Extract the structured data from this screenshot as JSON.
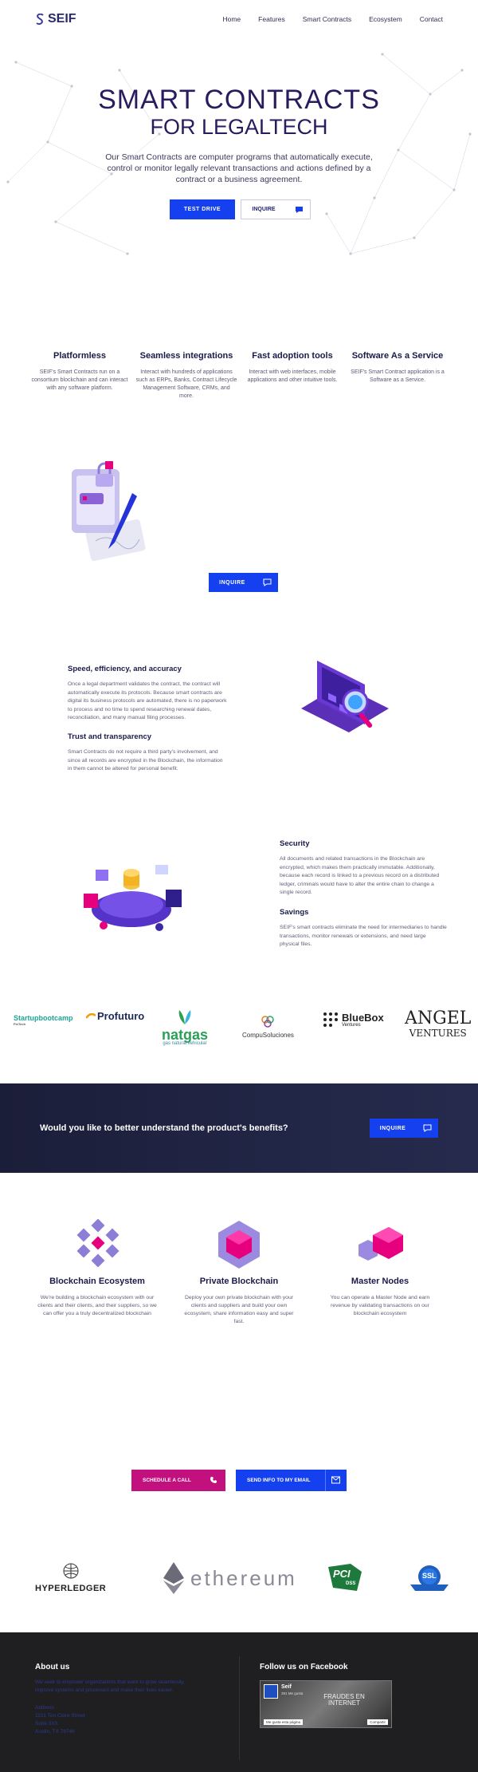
{
  "nav": {
    "brand": "SEIF",
    "links": [
      "Home",
      "Features",
      "Smart Contracts",
      "Ecosystem",
      "Contact"
    ]
  },
  "hero": {
    "title": "SMART CONTRACTS",
    "subtitle": "FOR LEGALTECH",
    "description": "Our Smart Contracts are computer programs that automatically execute, control or monitor legally relevant transactions and actions defined by a contract or a business agreement.",
    "test_drive": "TEST DRIVE",
    "inquire": "INQUIRE"
  },
  "features": [
    {
      "title": "Platformless",
      "text": "SEIF's Smart Contracts run on a consortium blockchain and can interact with any software platform."
    },
    {
      "title": "Seamless integrations",
      "text": "Interact with hundreds of applications such as ERPs, Banks, Contract Lifecycle Management Software, CRMs, and more."
    },
    {
      "title": "Fast adoption tools",
      "text": "Interact with web interfaces, mobile applications and other intuitive tools."
    },
    {
      "title": "Software As a Service",
      "text": "SEIF's Smart Contract application is a Software as a Service."
    }
  ],
  "inquire2": "INQUIRE",
  "benefits1": [
    {
      "title": "Speed, efficiency, and accuracy",
      "text": "Once a legal department validates the contract, the contract will automatically execute its protocols. Because smart contracts are digital its business protocols are automated, there is no paperwork to process and no time to spend researching renewal dates, reconciliation, and many manual filing processes."
    },
    {
      "title": "Trust and transparency",
      "text": "Smart Contracts do not require a third party's involvement, and since all records are encrypted in the Blockchain, the information in them cannot be altered for personal benefit."
    }
  ],
  "benefits2": [
    {
      "title": "Security",
      "text": "All documents and related transactions in the Blockchain are encrypted, which makes them practically immutable. Additionally, because each record is linked to a previous record on a distributed ledger, criminals would have to alter the entire chain to change a single record."
    },
    {
      "title": "Savings",
      "text": "SEIF's smart contracts eliminate the need for intermediaries to handle transactions, monitor renewals or extensions, and need large physical files."
    }
  ],
  "partners": {
    "startupbootcamp": "Startupbootcamp",
    "startup_sub": "FinTech",
    "profuturo": "Profuturo",
    "natgas": "natgas",
    "natgas_sub": "gas natural vehicular",
    "compu": "CompuSoluciones",
    "bluebox": "BlueBox",
    "bluebox_sub": "Ventures",
    "angel1": "ANGEL",
    "angel2": "VENTURES"
  },
  "cta": {
    "question": "Would you like to better understand the product's benefits?",
    "inquire": "INQUIRE"
  },
  "ecosystem": [
    {
      "title": "Blockchain Ecosystem",
      "text": "We're building a blockchain ecosystem with our clients and their clients, and their suppliers, so we can offer you a truly decentralized blockchain"
    },
    {
      "title": "Private Blockchain",
      "text": "Deploy your own private blockchain with your clients and suppliers and build your own ecosystem, share information easy and super fast."
    },
    {
      "title": "Master Nodes",
      "text": "You can operate a Master Node and earn revenue by validating transactions on our blockchain ecosystem"
    }
  ],
  "contact": {
    "schedule": "SCHEDULE A CALL",
    "send_info": "SEND INFO TO MY EMAIL"
  },
  "tech": {
    "hyperledger": "HYPERLEDGER",
    "ethereum": "ethereum",
    "pci": "PCI",
    "dss": "DSS",
    "ssl": "SSL"
  },
  "footer": {
    "about_title": "About us",
    "about_text": "We seek to empower organizations that want to grow seamlessly, improve systems and processes and make their lives easier.",
    "address_label": "Address",
    "address_lines": [
      "1101 Ten Clare Street",
      "Suite 3XX",
      "Austin, TX 78746"
    ],
    "follow_title": "Follow us on Facebook",
    "fb_name": "Seif",
    "fb_likes": "391 Me gusta",
    "fb_badge": "FRAUDES EN INTERNET",
    "fb_like_btn": "Me gusta esta página",
    "fb_share_btn": "Compartir"
  },
  "colors": {
    "accent": "#1440f0",
    "magenta": "#c2117e",
    "navy": "#2a1a5e"
  }
}
